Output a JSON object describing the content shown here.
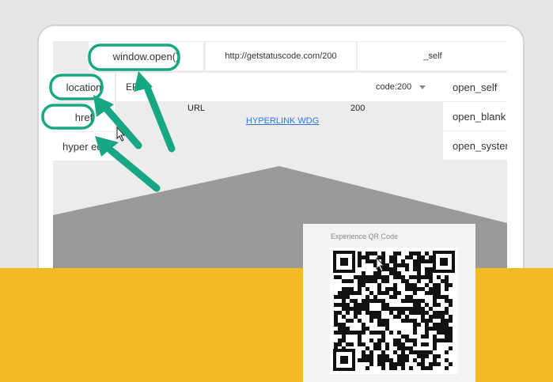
{
  "toolbar": {
    "window_open": "window.open()",
    "url_value": "http://getstatuscode.com/200",
    "target_value": "_self"
  },
  "left_panel": {
    "location": "location",
    "href": "href",
    "hyper": "hyper ed"
  },
  "err_input": {
    "value": "ERI"
  },
  "code_select": {
    "value": "code:200",
    "icon": "chevron-down-icon"
  },
  "right_panel": {
    "open_self": "open_self",
    "open_blank": "open_blank",
    "open_system": "open_system"
  },
  "labels": {
    "url": "URL",
    "code": "200",
    "hyperlink": "HYPERLINK WDG"
  },
  "qr_card": {
    "title": "Experience QR Code"
  },
  "colors": {
    "annotation_green": "#17a783",
    "band_yellow": "#f2bb22",
    "link_blue": "#2c7be5"
  }
}
